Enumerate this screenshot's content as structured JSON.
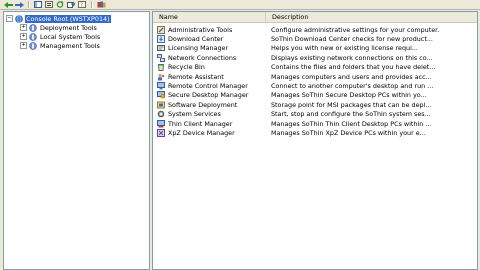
{
  "toolbar": {
    "buttons": [
      {
        "name": "back-button",
        "icon": "back-arrow-icon"
      },
      {
        "name": "forward-button",
        "icon": "forward-arrow-icon"
      },
      {
        "name": "show-hide-tree-button",
        "icon": "console-tree-icon"
      },
      {
        "name": "properties-button",
        "icon": "properties-icon"
      },
      {
        "name": "refresh-button",
        "icon": "refresh-icon"
      },
      {
        "name": "export-list-button",
        "icon": "export-icon"
      },
      {
        "name": "help-button",
        "icon": "help-icon"
      },
      {
        "name": "snapin-button",
        "icon": "books-icon"
      }
    ]
  },
  "tree": {
    "root": {
      "label": "Console Root (WSTXP014)",
      "icon": "console-root-icon"
    },
    "items": [
      {
        "label": "Deployment Tools",
        "icon": "tools-folder-icon"
      },
      {
        "label": "Local System Tools",
        "icon": "tools-folder-icon"
      },
      {
        "label": "Management Tools",
        "icon": "tools-folder-icon"
      }
    ]
  },
  "list": {
    "columns": {
      "name": "Name",
      "description": "Description"
    },
    "rows": [
      {
        "name": "Administrative Tools",
        "description": "Configure administrative settings for your computer.",
        "icon": "admin-tools-icon"
      },
      {
        "name": "Download Center",
        "description": "SoThin Download Center checks for new product...",
        "icon": "download-center-icon"
      },
      {
        "name": "Licensing Manager",
        "description": "Helps you with new or existing license requi...",
        "icon": "license-icon"
      },
      {
        "name": "Network Connections",
        "description": "Displays existing network connections on this co...",
        "icon": "network-icon"
      },
      {
        "name": "Recycle Bin",
        "description": "Contains the files and folders that you have delet...",
        "icon": "recycle-bin-icon"
      },
      {
        "name": "Remote Assistant",
        "description": "Manages computers and users and provides acc...",
        "icon": "remote-assistant-icon"
      },
      {
        "name": "Remote Control Manager",
        "description": "Connect to another computer's desktop and run ...",
        "icon": "remote-control-icon"
      },
      {
        "name": "Secure Desktop Manager",
        "description": "Manages SoThin Secure Desktop PCs within yo...",
        "icon": "secure-desktop-icon"
      },
      {
        "name": "Software Deployment",
        "description": "Storage point for MSI packages that can be depl...",
        "icon": "software-deploy-icon"
      },
      {
        "name": "System Services",
        "description": "Start, stop and configure the SoThin system ses...",
        "icon": "system-services-icon"
      },
      {
        "name": "Thin Client Manager",
        "description": "Manages SoThin Thin Client Desktop PCs within ...",
        "icon": "thin-client-icon"
      },
      {
        "name": "XpZ Device Manager",
        "description": "Manages SoThin XpZ Device PCs within your e...",
        "icon": "device-manager-icon"
      }
    ]
  },
  "colors": {
    "selection": "#316ac5",
    "pane_border": "#7f9db9",
    "window_bg": "#ece9d8",
    "header_bg": "#ebeadb"
  }
}
